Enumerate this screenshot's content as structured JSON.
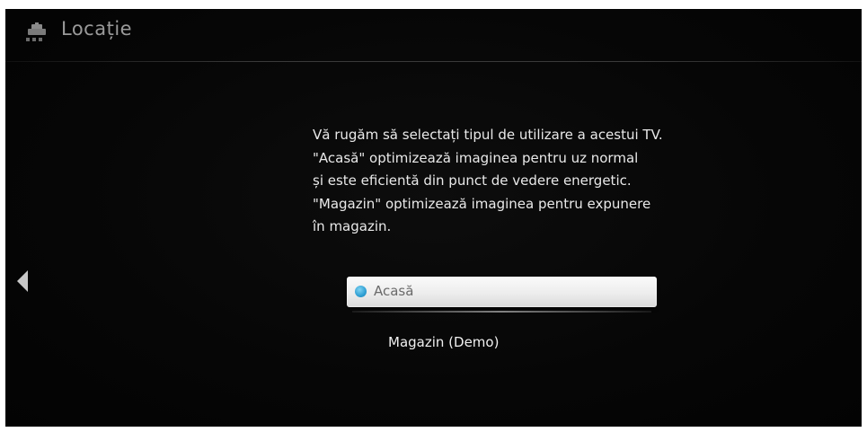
{
  "header": {
    "icon": "toolbox-setup-icon",
    "title": "Locație"
  },
  "navigation": {
    "left_arrow_icon": "triangle-left-icon"
  },
  "description": {
    "lines": [
      "Vă rugăm să selectați tipul de utilizare a acestui TV.",
      "\"Acasă\" optimizează imaginea pentru uz normal",
      "și este eficientă din punct de vedere energetic.",
      "\"Magazin\" optimizează imaginea pentru expunere",
      "în magazin."
    ]
  },
  "options": [
    {
      "label": "Acasă",
      "selected": true
    },
    {
      "label": "Magazin (Demo)",
      "selected": false
    }
  ],
  "colors": {
    "background": "#060606",
    "text": "#e9e9e9",
    "header_text": "#9a9a9a",
    "radio_accent": "#2f9fd3",
    "selected_bar": "#f2f2f2"
  }
}
